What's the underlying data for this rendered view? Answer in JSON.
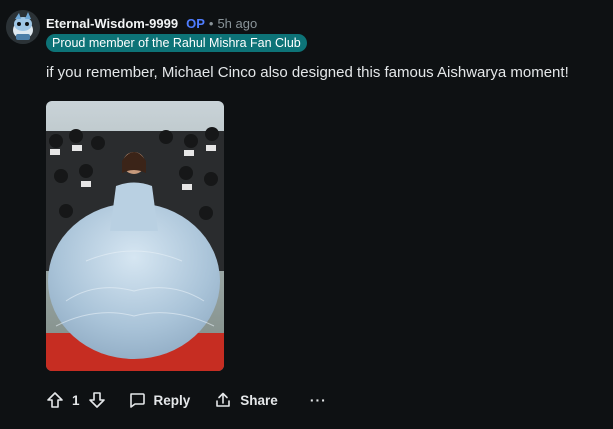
{
  "comment": {
    "author": "Eternal-Wisdom-9999",
    "op_badge": "OP",
    "separator": "•",
    "time": "5h ago",
    "flair": "Proud member of the Rahul Mishra Fan Club",
    "body": "if you remember, Michael Cinco also designed this famous Aishwarya moment!",
    "avatar_icon": "snoo-avatar-icon",
    "image": "red-carpet-ballgown-photo"
  },
  "actions": {
    "upvote_icon": "upvote-arrow-icon",
    "vote_count": "1",
    "downvote_icon": "downvote-arrow-icon",
    "reply_icon": "comment-bubble-icon",
    "reply_label": "Reply",
    "share_icon": "share-icon",
    "share_label": "Share",
    "more_label": "···"
  },
  "colors": {
    "background": "#0e1113",
    "flair_bg": "#0d7377",
    "op_color": "#4f7dff"
  }
}
